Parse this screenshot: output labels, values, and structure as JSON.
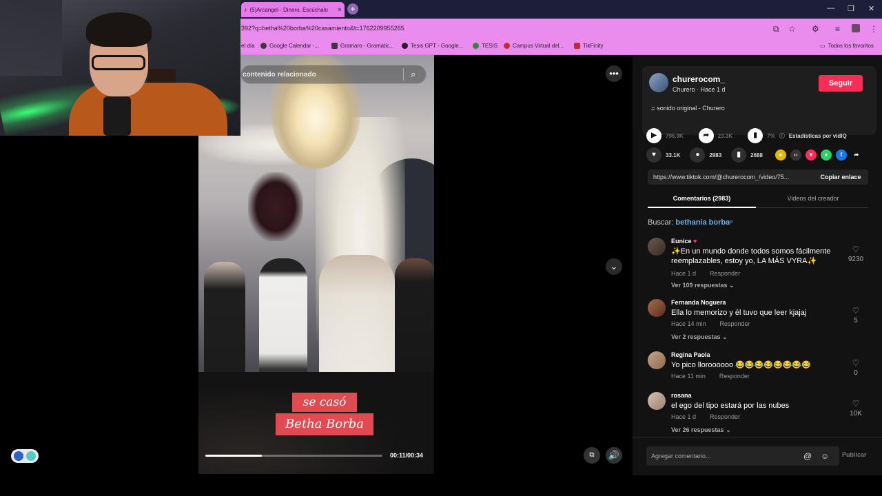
{
  "browser": {
    "tab_title": "(5)Arcangel - Dinero, Escúchalo",
    "url": "392?q=betha%20borba%20casamiento&t=1762209955265",
    "bookmarks": [
      "el día",
      "Google Calendar -...",
      "Gramaro - Gramátic...",
      "Tesis GPT - Google...",
      "TESIS",
      "Campus Virtual del...",
      "TikFinity"
    ],
    "all_bookmarks": "Todos los favoritos"
  },
  "video": {
    "search_placeholder": "contenido relacionado",
    "caption_line1": "se casó",
    "caption_line2": "Betha Borba",
    "time": "00:11/00:34",
    "progress": 0.32
  },
  "creator": {
    "username": "churerocom_",
    "meta": "Churero · Hace 1 d",
    "follow_label": "Seguir",
    "sound": "sonido original - Churero"
  },
  "actions": {
    "plays": "796.9K",
    "shares": "23.3K",
    "percent": "7%",
    "vidiq": "Estadísticas por vidIQ",
    "likes": "33.1K",
    "comments": "2983",
    "saves": "2688"
  },
  "link": {
    "url": "https://www.tiktok.com/@churerocom_/video/75...",
    "copy_label": "Copiar enlace"
  },
  "tabs": {
    "comments": "Comentarios (2983)",
    "creator_videos": "Videos del creador"
  },
  "search_for": {
    "label": "Buscar:",
    "query": "bethania borba"
  },
  "comments": [
    {
      "name": "Eunice",
      "text": "✨En un mundo donde todos somos fácilmente reemplazables, estoy yo, LA MÁS VYRA✨",
      "time": "Hace 1 d",
      "reply": "Responder",
      "replies": "Ver 109 respuestas",
      "likes": "9230"
    },
    {
      "name": "Fernanda Noguera",
      "text": "Ella lo memorizo y él tuvo que leer kjajaj",
      "time": "Hace 14 min",
      "reply": "Responder",
      "replies": "Ver 2 respuestas",
      "likes": "5"
    },
    {
      "name": "Regina Paola",
      "text": "Yo pico lloroooooo 😂😂😂😂😂😂😂😂",
      "time": "Hace 11 min",
      "reply": "Responder",
      "replies": "",
      "likes": "0"
    },
    {
      "name": "rosana",
      "text": "el ego del tipo estará por las nubes",
      "time": "Hace 1 d",
      "reply": "Responder",
      "replies": "Ver 26 respuestas",
      "likes": "10K"
    }
  ],
  "comment_bar": {
    "placeholder": "Agregar comentario...",
    "post_label": "Publicar"
  }
}
